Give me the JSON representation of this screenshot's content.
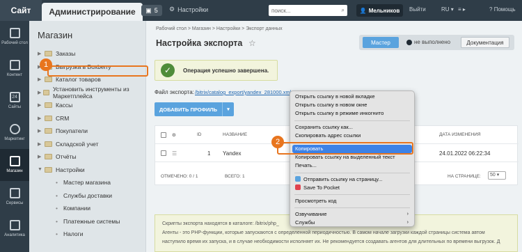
{
  "topbar": {
    "site_tab": "Сайт",
    "admin_tab": "Администрирование",
    "notifications_count": "5",
    "settings_label": "Настройки",
    "search_placeholder": "поиск...",
    "user_name": "Мельников",
    "exit_label": "Выйти",
    "lang_label": "RU",
    "help_label": "Помощь"
  },
  "leftbar": [
    {
      "label": "Рабочий стол",
      "icon": "home-icon"
    },
    {
      "label": "Контент",
      "icon": "document-icon"
    },
    {
      "label": "Сайты",
      "icon": "calendar-icon",
      "badge": "24"
    },
    {
      "label": "Маркетинг",
      "icon": "target-icon"
    },
    {
      "label": "Магазин",
      "icon": "cart-icon",
      "active": true
    },
    {
      "label": "Сервисы",
      "icon": "layers-icon"
    },
    {
      "label": "Аналитика",
      "icon": "chart-icon"
    }
  ],
  "menu": {
    "title": "Магазин",
    "items": [
      "Заказы",
      "Выгрузка в Boxberry",
      "Каталог товаров",
      "Установить инструменты из Маркетплейса",
      "Кассы",
      "CRM",
      "Покупатели",
      "Складской учет",
      "Отчёты",
      "Настройки"
    ],
    "subitems": [
      "Мастер магазина",
      "Службы доставки",
      "Компании",
      "Платежные системы",
      "Налоги"
    ]
  },
  "main": {
    "breadcrumb": "Рабочий стол  >  Магазин  >  Настройки  >  Экспорт данных",
    "title": "Настройка экспорта",
    "switch_master": "Мастер",
    "switch_state": "не выполнено",
    "switch_docs": "Документация",
    "success_text": "Операция успешно завершена.",
    "file_label": "Файл экспорта:",
    "file_link": "/bitrix/catalog_export/yandex_281000.xml",
    "add_button": "ДОБАВИТЬ ПРОФИЛЬ",
    "columns": {
      "id": "ID",
      "name": "НАЗВАНИЕ",
      "changed": "ДАТА ИЗМЕНЕНИЯ"
    },
    "row": {
      "id": "1",
      "name": "Yandex",
      "date": "24.01.2022 06:22:34"
    },
    "selected_label": "ОТМЕЧЕНО: 0 / 1",
    "total_label": "ВСЕГО: 1",
    "per_page_label": "НА СТРАНИЦЕ:",
    "per_page_value": "50",
    "info_line1": "Скрипты экспорта находятся в каталоге: /bitrix/php_",
    "info_line2": "Агенты - это PHP-функции, которые запускаются с определенной периодичностью. В самом начале загрузки каждой страницы система автом",
    "info_line3": "наступило время их запуска, и в случае необходимости исполняет их. Не рекомендуется создавать агентов для длительных по времени выгрузок. Д"
  },
  "badges": {
    "one": "1",
    "two": "2"
  },
  "context_menu": {
    "group1": [
      "Открыть ссылку в новой вкладке",
      "Открыть ссылку в новом окне",
      "Открыть ссылку в режиме инкогнито"
    ],
    "group2": [
      "Сохранить ссылку как...",
      "Скопировать адрес ссылки"
    ],
    "group3": [
      "Копировать",
      "Копировать ссылку на выделенный текст",
      "Печать..."
    ],
    "group4": [
      "Отправить ссылку на страницу...",
      "Save To Pocket"
    ],
    "group5": [
      "Просмотреть код"
    ],
    "group6": [
      "Озвучивание",
      "Службы"
    ]
  },
  "colors": {
    "accent": "#5aa3de",
    "highlight": "#e8751e",
    "topbar": "#2f3d48",
    "menu_highlight": "#3d82e6"
  }
}
